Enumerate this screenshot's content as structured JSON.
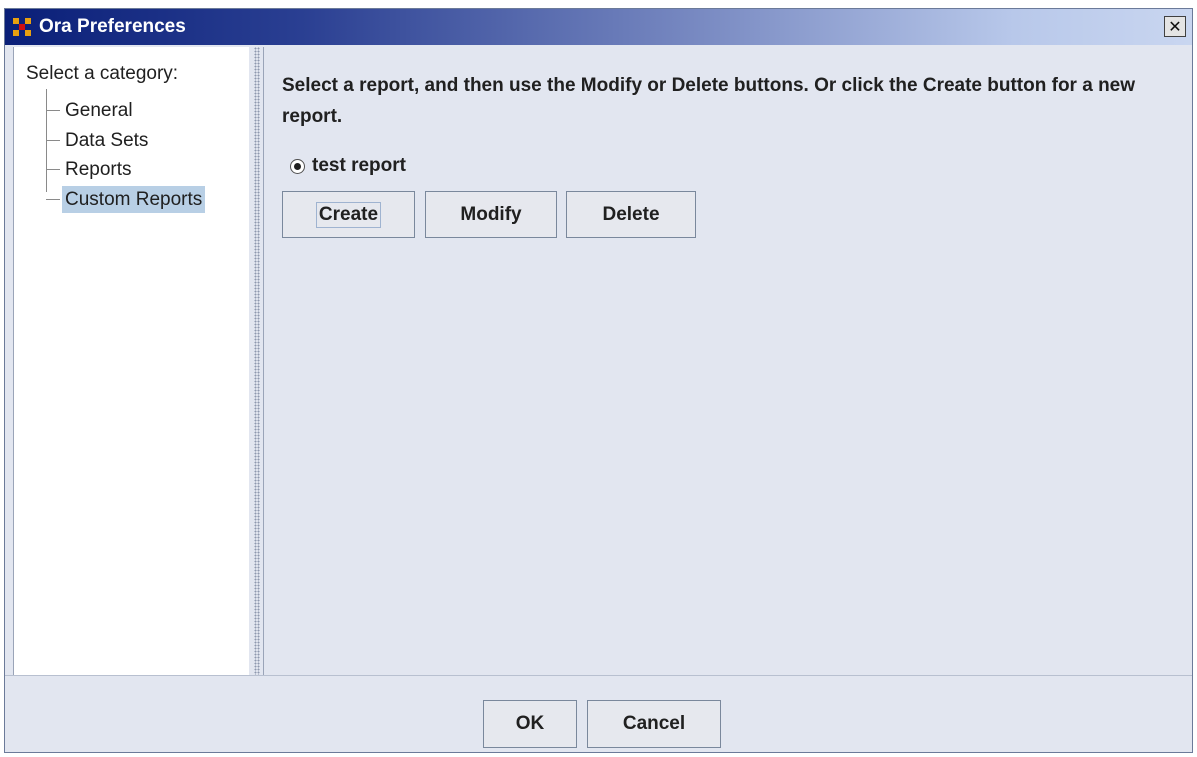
{
  "window": {
    "title": "Ora Preferences",
    "close_symbol": "✕"
  },
  "icons": {
    "app": "ora-app-icon",
    "close": "close-icon",
    "radio": "radio-selected-icon"
  },
  "sidebar": {
    "heading": "Select a category:",
    "items": [
      {
        "label": "General",
        "selected": false
      },
      {
        "label": "Data Sets",
        "selected": false
      },
      {
        "label": "Reports",
        "selected": false
      },
      {
        "label": "Custom Reports",
        "selected": true
      }
    ]
  },
  "main": {
    "instructions": "Select a report, and then use the Modify or Delete buttons. Or click the Create button for a new report.",
    "reports": [
      {
        "label": "test report",
        "selected": true
      }
    ],
    "buttons": {
      "create": "Create",
      "modify": "Modify",
      "delete": "Delete"
    }
  },
  "footer": {
    "ok": "OK",
    "cancel": "Cancel"
  },
  "colors": {
    "title_gradient_start": "#0a1f78",
    "title_gradient_end": "#c9d6f0",
    "panel_background": "#e2e6f0",
    "selection": "#b8cfe5"
  }
}
